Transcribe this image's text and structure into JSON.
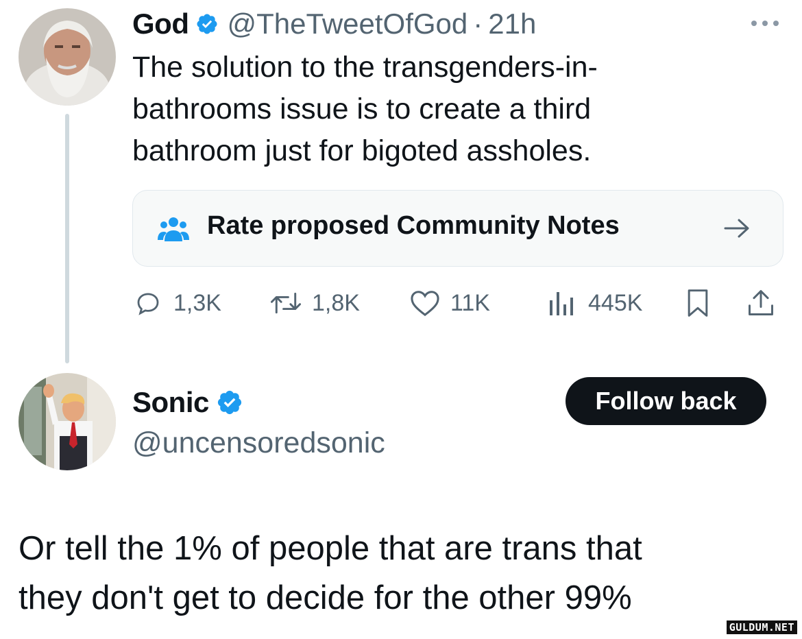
{
  "tweet": {
    "author_name": "God",
    "author_handle": "@TheTweetOfGod",
    "separator": "·",
    "time": "21h",
    "more": "···",
    "text_lines": [
      "The solution to the transgenders-in-",
      "bathrooms issue is to create a third",
      "bathroom just for bigoted assholes."
    ],
    "community_notes_label": "Rate proposed Community Notes",
    "community_notes_arrow": "→",
    "stats": {
      "replies": "1,3K",
      "reposts": "1,8K",
      "likes": "11K",
      "views": "445K"
    }
  },
  "profile": {
    "name": "Sonic",
    "handle": "@uncensoredsonic",
    "follow_label": "Follow back"
  },
  "reply": {
    "text_lines": [
      "Or tell the 1% of people that are trans that",
      "they don't get to decide for the other 99%"
    ]
  },
  "watermark": "GULDUM.NET",
  "colors": {
    "verified": "#1d9bf0",
    "muted": "#536471",
    "text": "#0f1419",
    "button_bg": "#0f1419"
  }
}
